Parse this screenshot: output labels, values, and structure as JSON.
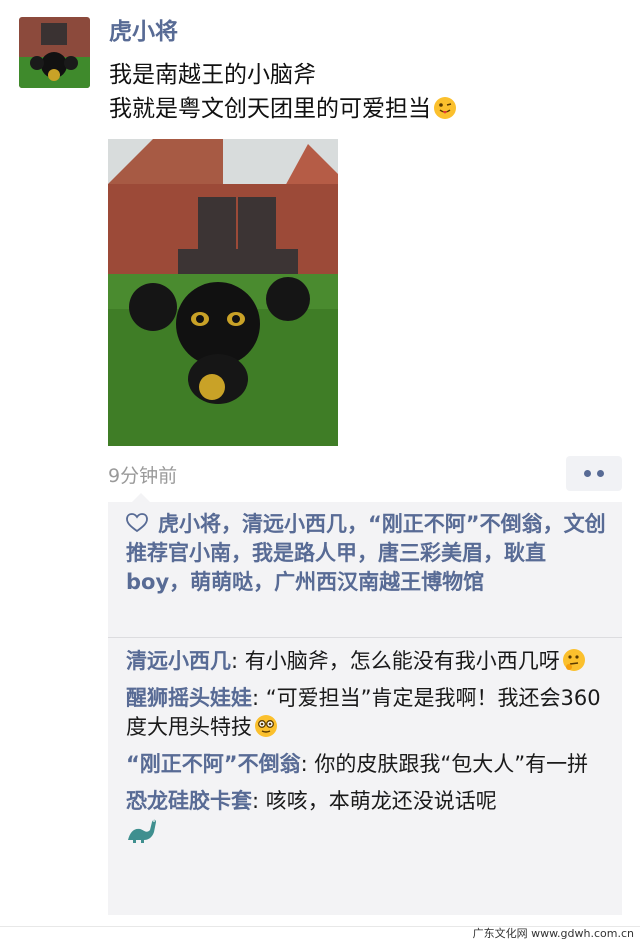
{
  "post": {
    "author": "虎小将",
    "lines": [
      "我是南越王的小脑斧",
      "我就是粤文创天团里的可爱担当"
    ],
    "time": "9分钟前"
  },
  "icons": {
    "avatar": "tiger-figurine-avatar",
    "emoji_post": "tongue-wink-emoji",
    "like": "heart-outline-icon",
    "more": "more-dots-icon"
  },
  "likes": {
    "names": "虎小将，清远小西几，“刚正不阿”不倒翁，文创推荐官小南，我是路人甲，唐三彩美眉，耿直boy，萌萌哒，广州西汉南越王博物馆"
  },
  "comments": [
    {
      "name": "清远小西几",
      "text": ": 有小脑斧，怎么能没有我小西几呀"
    },
    {
      "name": "醒狮摇头娃娃",
      "text": ": “可爱担当”肯定是我啊！我还会360度大甩头特技"
    },
    {
      "name": "“刚正不阿”不倒翁",
      "text": ": 你的皮肤跟我“包大人”有一拼"
    },
    {
      "name": "恐龙硅胶卡套",
      "text": ": 咳咳，本萌龙还没说话呢"
    }
  ],
  "watermark": "广东文化网 www.gdwh.com.cn",
  "colors": {
    "name_blue": "#586b95",
    "comment_bg": "#f3f3f5"
  }
}
